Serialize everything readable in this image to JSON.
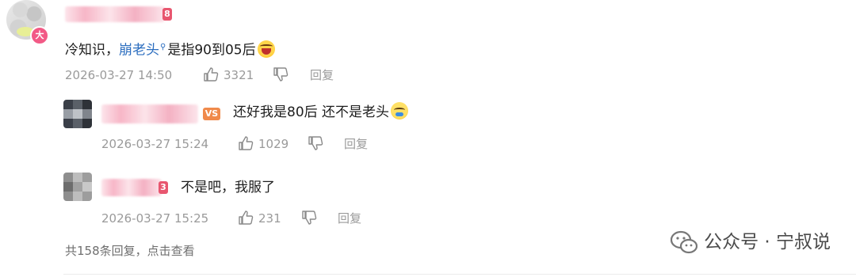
{
  "comments": [
    {
      "level_badge": "8",
      "vip_badge": "大",
      "text_before": "冷知识，",
      "topic_link": "崩老头",
      "text_after": "是指90到05后",
      "emoji": "laugh-emoji",
      "timestamp": "2026-03-27 14:50",
      "likes": "3321",
      "reply_label": "回复"
    },
    {
      "level_badge": "VS",
      "text": "还好我是80后 还不是老头",
      "emoji": "cry-laugh-emoji",
      "timestamp": "2026-03-27 15:24",
      "likes": "1029",
      "reply_label": "回复"
    },
    {
      "level_badge": "3",
      "text": "不是吧，我服了",
      "timestamp": "2026-03-27 15:25",
      "likes": "231",
      "reply_label": "回复"
    }
  ],
  "footer": {
    "more_replies": "共158条回复，点击查看"
  },
  "watermark": {
    "text": "公众号 · 宁叔说",
    "icon": "wechat-icon"
  },
  "colors": {
    "link": "#2b6dbf",
    "meta": "#9a9a9a",
    "badge_pink": "#f25a86",
    "level_red": "#e8566f",
    "level_orange": "#f08a4b"
  }
}
